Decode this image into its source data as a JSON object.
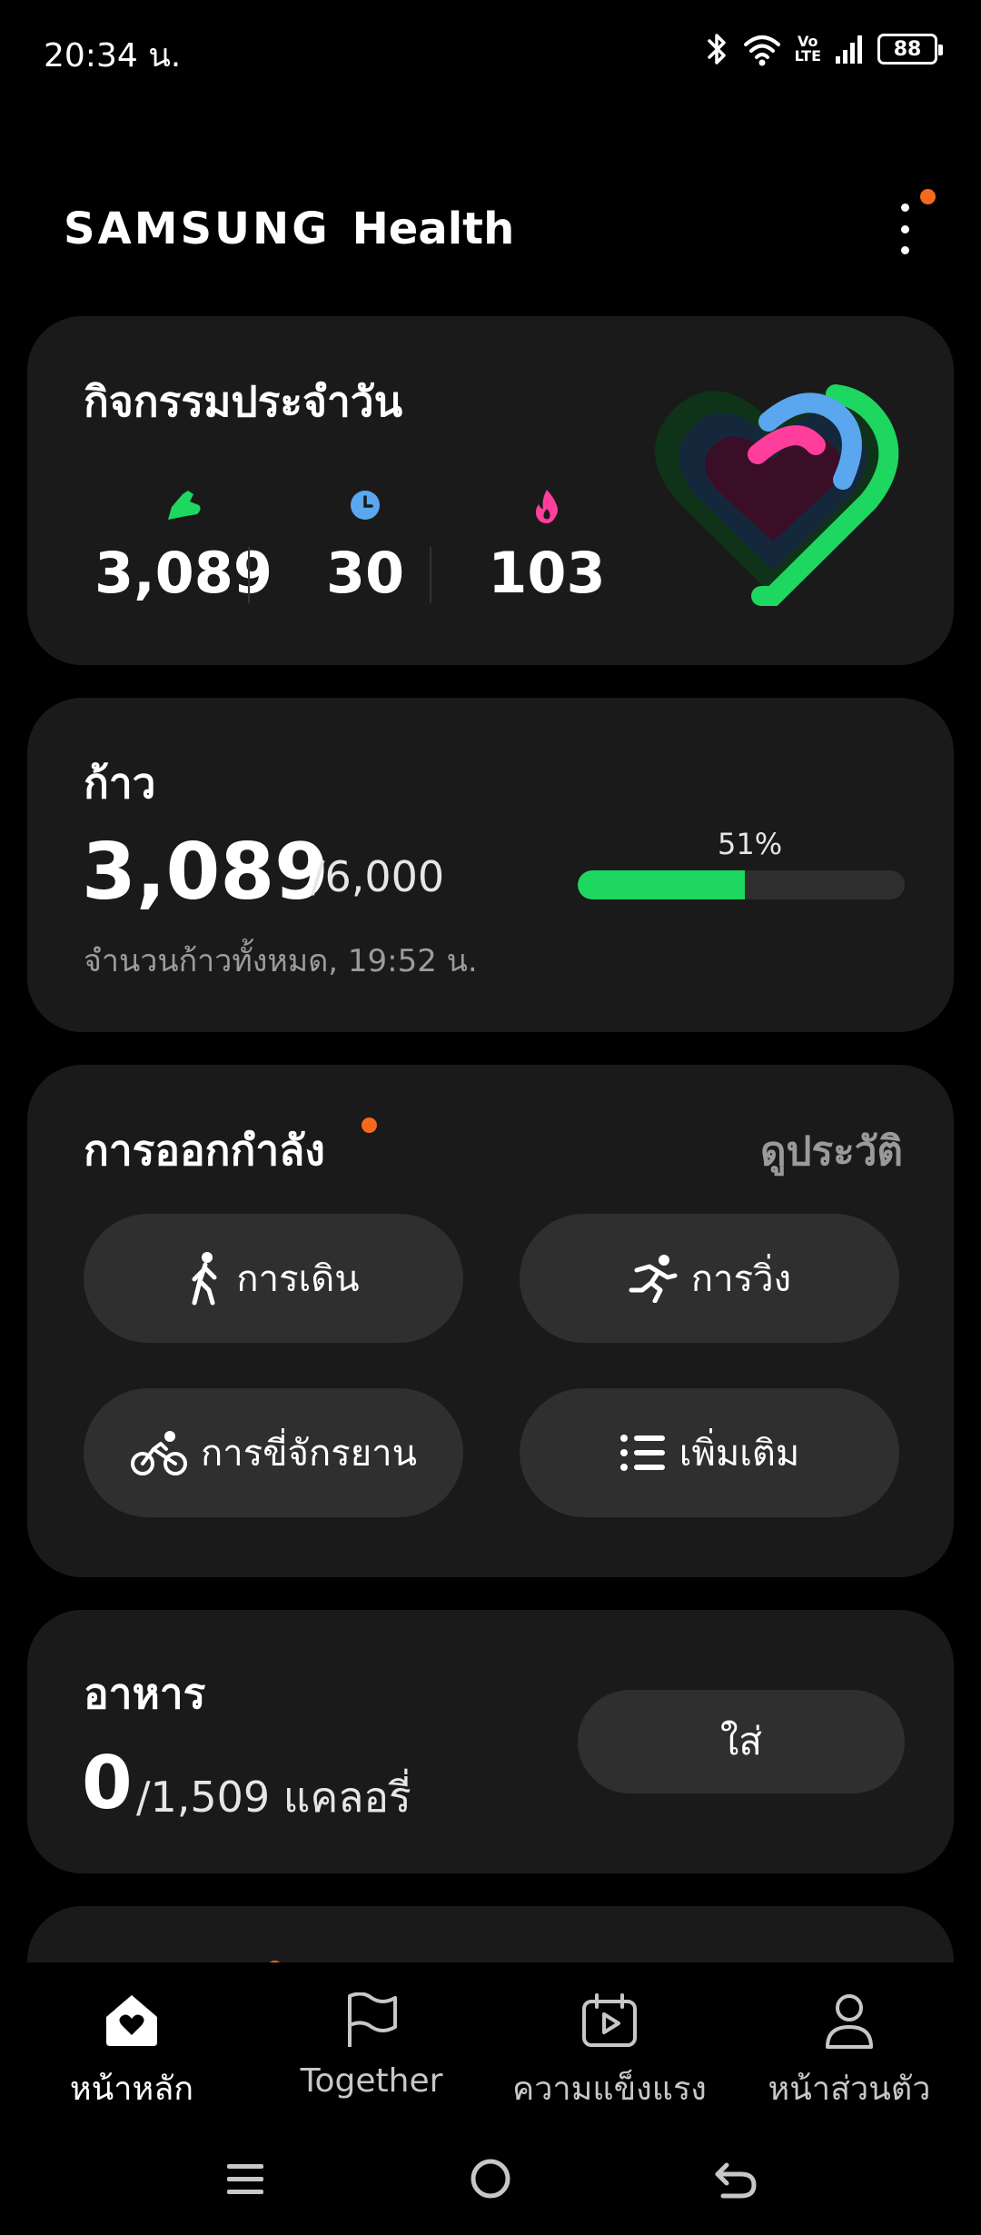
{
  "status_bar": {
    "time": "20:34 น.",
    "volte_top": "Vo",
    "volte_bottom": "LTE",
    "battery": "88"
  },
  "header": {
    "brand": "SAMSUNG",
    "app": "Health"
  },
  "activity": {
    "title": "กิจกรรมประจำวัน",
    "stats": [
      {
        "icon": "shoe-icon",
        "value": "3,089",
        "color": "#1ed760"
      },
      {
        "icon": "clock-icon",
        "value": "30",
        "color": "#5aa7f0"
      },
      {
        "icon": "flame-icon",
        "value": "103",
        "color": "#ff3d9a"
      }
    ]
  },
  "steps": {
    "title": "ก้าว",
    "value": "3,089",
    "goal": "/6,000",
    "subtitle": "จำนวนก้าวทั้งหมด, 19:52 น.",
    "progress_label": "51%",
    "progress_fraction": 0.51
  },
  "exercise": {
    "title": "การออกกำลัง",
    "history": "ดูประวัติ",
    "buttons": [
      {
        "label": "การเดิน",
        "icon": "walking-icon"
      },
      {
        "label": "การวิ่ง",
        "icon": "running-icon"
      },
      {
        "label": "การขี่จักรยาน",
        "icon": "cycling-icon"
      },
      {
        "label": "เพิ่มเติม",
        "icon": "list-icon"
      }
    ]
  },
  "food": {
    "title": "อาหาร",
    "value": "0",
    "goal": "/1,509 แคลอรี่",
    "add_label": "ใส่"
  },
  "nav": [
    {
      "label": "หน้าหลัก",
      "icon": "home-heart-icon"
    },
    {
      "label": "Together",
      "icon": "flag-icon"
    },
    {
      "label": "ความแข็งแรง",
      "icon": "calendar-play-icon"
    },
    {
      "label": "หน้าส่วนตัว",
      "icon": "person-icon"
    }
  ],
  "colors": {
    "accent_green": "#1ed760",
    "accent_blue": "#5aa7f0",
    "accent_pink": "#ff3d9a",
    "notification_dot": "#f36a1f",
    "card_bg": "#1a1a1a"
  }
}
